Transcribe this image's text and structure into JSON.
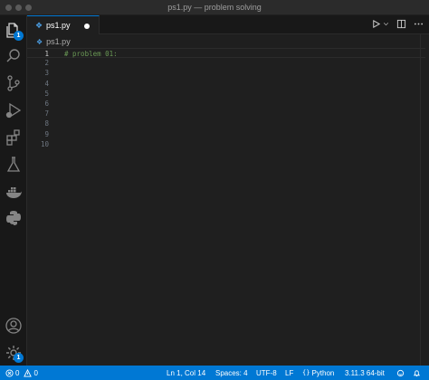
{
  "window": {
    "title": "ps1.py — problem solving"
  },
  "activity_bar": {
    "explorer_badge": "1",
    "settings_badge": "1"
  },
  "tab": {
    "label": "ps1.py",
    "icon": "python-file-icon"
  },
  "breadcrumb": {
    "file": "ps1.py"
  },
  "editor": {
    "lines": [
      {
        "number": "1",
        "text": "# problem 01:"
      },
      {
        "number": "2",
        "text": ""
      },
      {
        "number": "3",
        "text": ""
      },
      {
        "number": "4",
        "text": ""
      },
      {
        "number": "5",
        "text": ""
      },
      {
        "number": "6",
        "text": ""
      },
      {
        "number": "7",
        "text": ""
      },
      {
        "number": "8",
        "text": ""
      },
      {
        "number": "9",
        "text": ""
      },
      {
        "number": "10",
        "text": ""
      }
    ]
  },
  "status_bar": {
    "errors": "0",
    "warnings": "0",
    "cursor": "Ln 1, Col 14",
    "spaces": "Spaces: 4",
    "encoding": "UTF-8",
    "eol": "LF",
    "language": "Python",
    "interpreter": "3.11.3 64-bit"
  },
  "colors": {
    "accent": "#0078d4",
    "comment": "#6a9955",
    "python_icon": "#4b9ce0"
  }
}
